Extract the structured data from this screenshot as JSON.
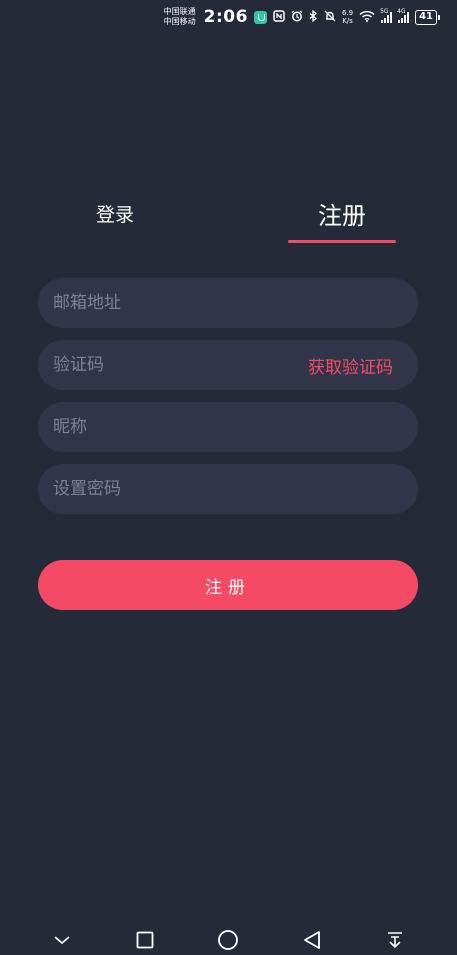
{
  "status_bar": {
    "carrier_1": "中国联通",
    "carrier_2": "中国移动",
    "time": "2:06",
    "net_speed_value": "6.9",
    "net_speed_unit": "K/s",
    "signal_1_tag": "5G",
    "signal_2_tag": "4G",
    "battery": "41"
  },
  "tabs": {
    "login_label": "登录",
    "register_label": "注册",
    "active": "register"
  },
  "form": {
    "email_placeholder": "邮箱地址",
    "code_placeholder": "验证码",
    "get_code_label": "获取验证码",
    "nickname_placeholder": "昵称",
    "password_placeholder": "设置密码",
    "submit_label": "注册"
  },
  "nav_bar": {
    "icons": [
      "chevron-down-icon",
      "square-icon",
      "circle-icon",
      "back-triangle-icon",
      "download-icon"
    ]
  },
  "colors": {
    "background": "#252a38",
    "field": "#30354a",
    "accent": "#f54a66",
    "placeholder": "#7c8196"
  }
}
